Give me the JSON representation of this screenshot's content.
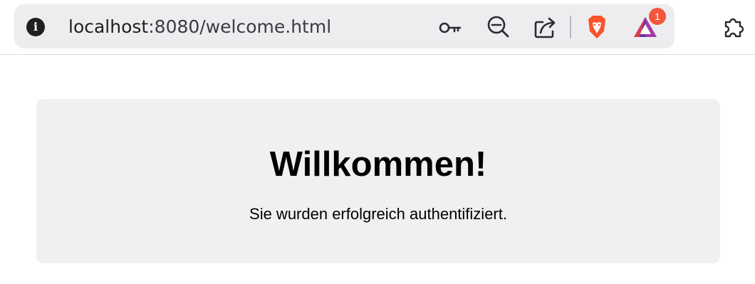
{
  "browser": {
    "site_info_icon": "info-icon",
    "url_host": "localhost",
    "url_rest": ":8080/welcome.html",
    "toolbar_icons": [
      "key-icon",
      "zoom-out-icon",
      "share-icon",
      "brave-shields-icon",
      "brave-rewards-icon",
      "extensions-icon"
    ],
    "rewards_badge": "1",
    "colors": {
      "omnibox_bg": "#ededf0",
      "brave_orange": "#fb542b",
      "rewards_purple": "#6b2fa8",
      "badge_red": "#f4563c"
    }
  },
  "page": {
    "heading": "Willkommen!",
    "message": "Sie wurden erfolgreich authentifiziert.",
    "card_bg": "#f0f0f0"
  }
}
